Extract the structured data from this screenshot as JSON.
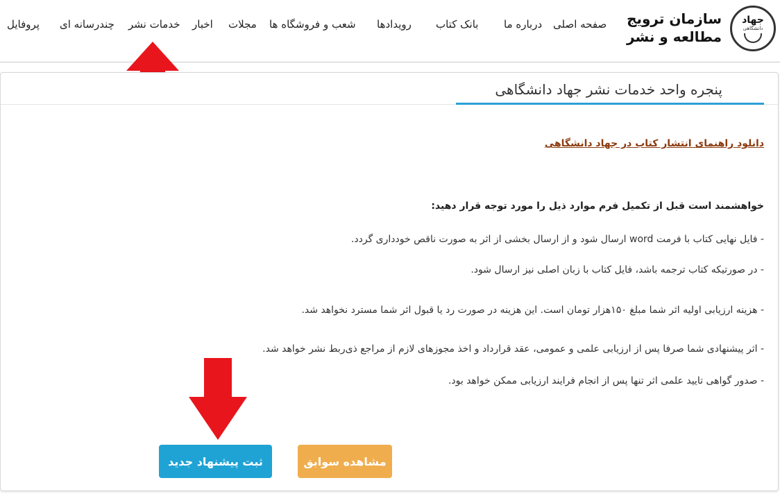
{
  "logo": {
    "emblem_word": "جهاد",
    "emblem_sub": "دانشگاهی",
    "line1": "سازمان ترویج",
    "line2": "مطالعه و نشر"
  },
  "nav": {
    "items": [
      {
        "label": "صفحه اصلی"
      },
      {
        "label": "درباره ما"
      },
      {
        "label": "بانک کتاب"
      },
      {
        "label": "رویدادها"
      },
      {
        "label": "شعب و فروشگاه ها"
      },
      {
        "label": "مجلات"
      },
      {
        "label": "اخبار"
      },
      {
        "label": "خدمات نشر"
      },
      {
        "label": "چندرسانه ای"
      },
      {
        "label": "پروفایل"
      }
    ]
  },
  "annotation_color": "#e8161c",
  "card": {
    "title": "پنجره واحد خدمات نشر جهاد دانشگاهی",
    "download_link": "دانلود راهنمای انتشار کتاب در جهاد دانشگاهی",
    "instructions_heading": "خواهشمند است قبل از تکمیل فرم موارد ذیل را مورد توجه قرار دهید:",
    "lines": [
      "- فایل نهایی  کتاب با فرمت word  ارسال شود و از ارسال بخشی از اثر به صورت ناقص خودداری گردد.",
      "- در صورتیکه کتاب ترجمه باشد، فایل کتاب با زبان اصلی  نیز ارسال شود.",
      "- هزینه ارزیابی اولیه اثر شما مبلغ ۱۵۰هزار تومان است. این هزینه در صورت رد یا قبول اثر شما مسترد نخواهد شد.",
      "- اثر پیشنهادی شما صرفا پس از ارزیابی علمی و عمومی، عقد قرارداد و اخذ مجوزهای لازم از مراجع ذی‌ربط نشر خواهد شد.",
      "- صدور گواهی تایید علمی اثر تنها پس از انجام فرایند ارزیابی ممکن خواهد بود."
    ],
    "history_button": "مشاهده سوابق",
    "new_button": "ثبت پیشنهاد جدید"
  }
}
